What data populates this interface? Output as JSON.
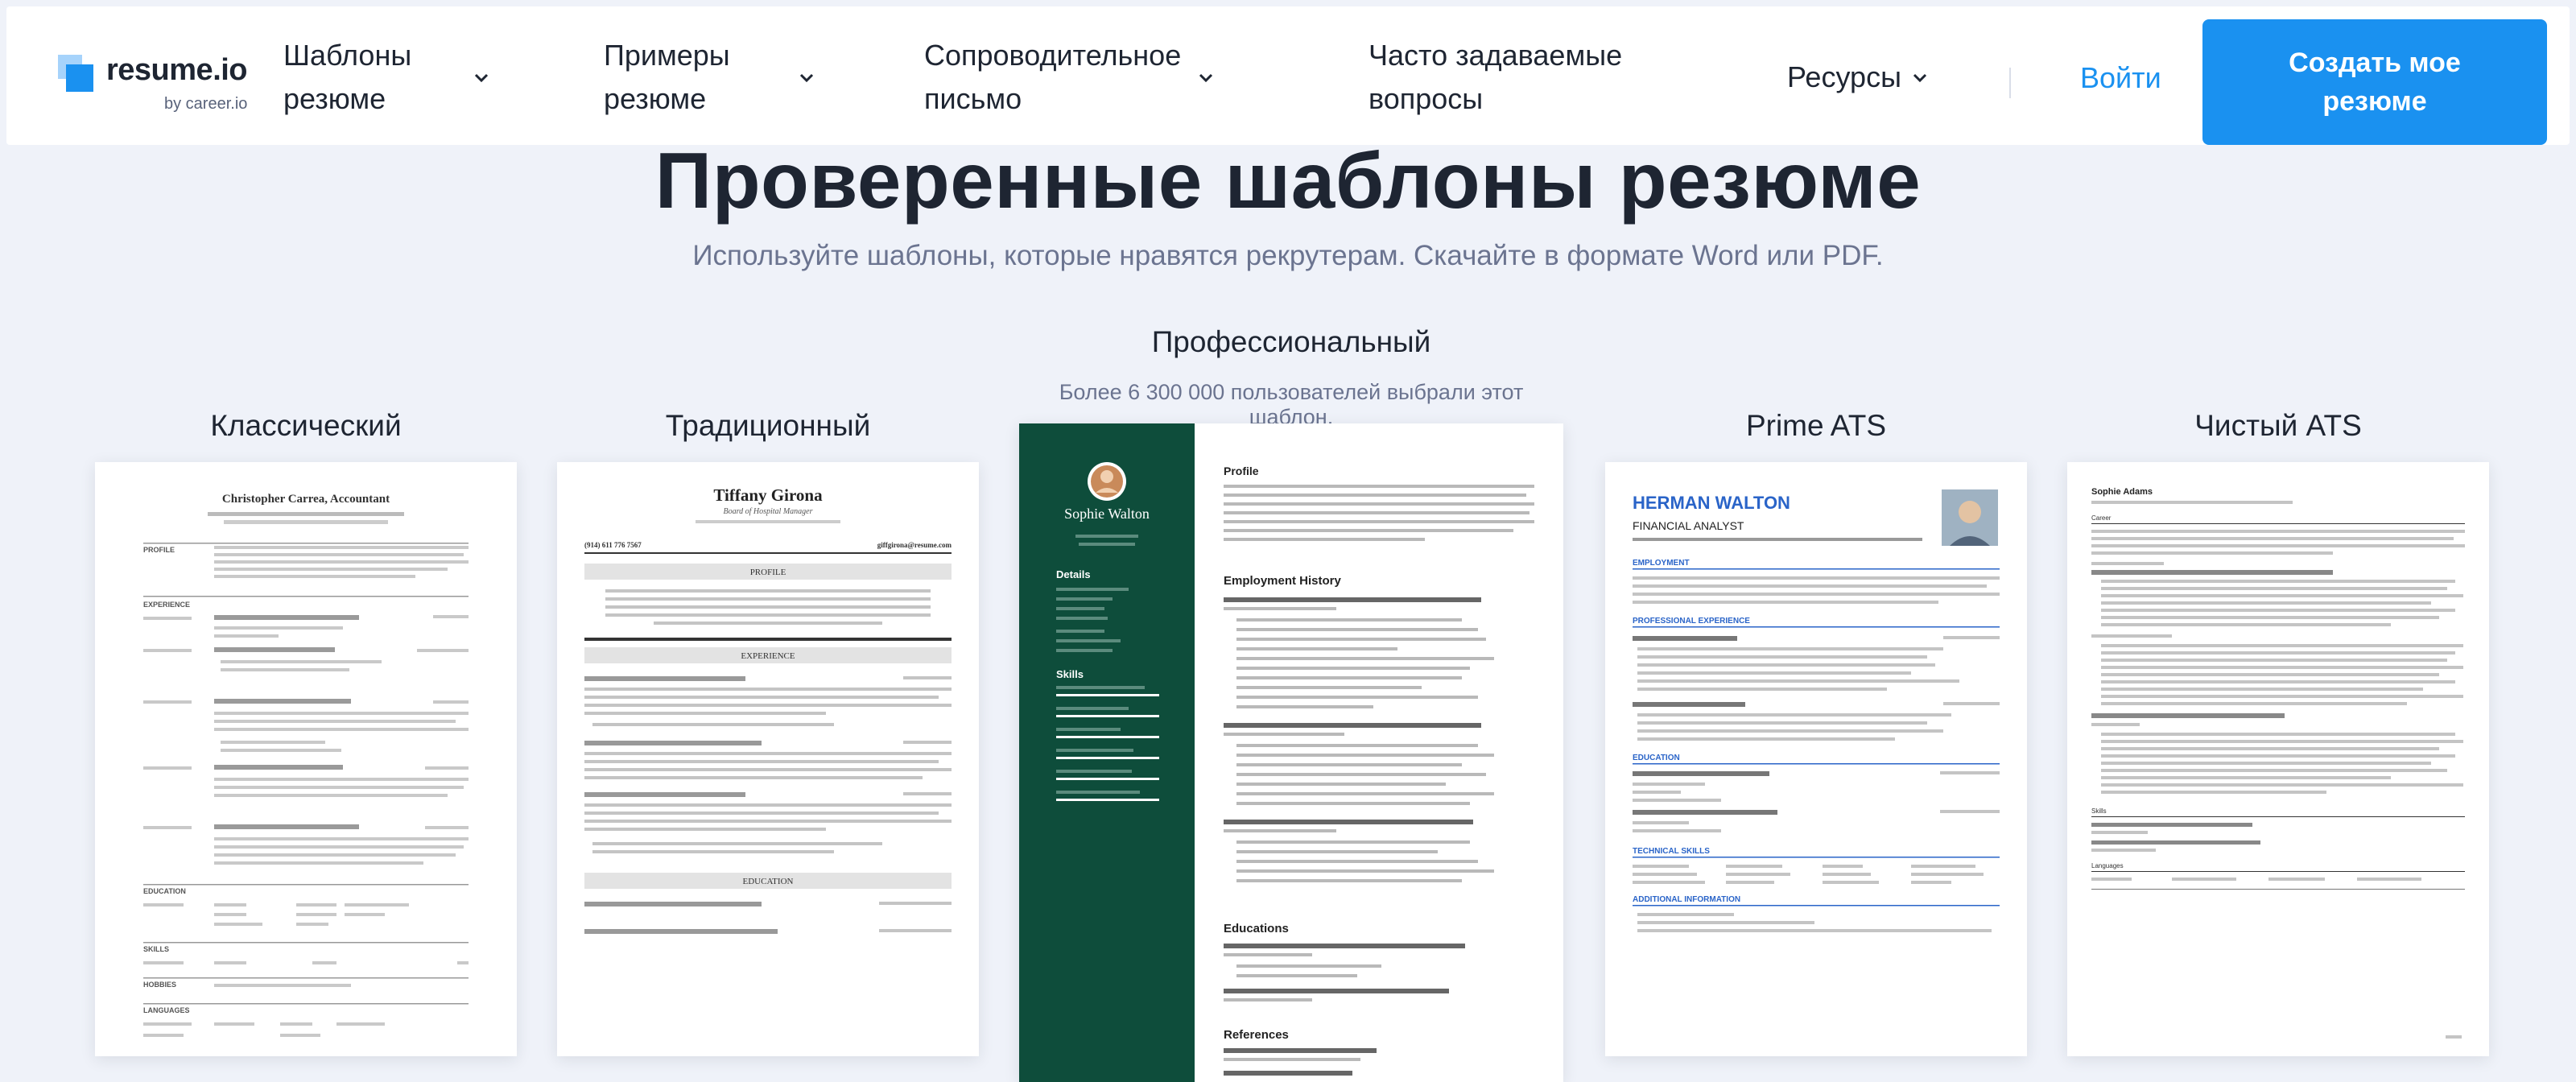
{
  "nav": {
    "logo_text": "resume.io",
    "logo_sub": "by career.io",
    "items": [
      {
        "line1": "Шаблоны",
        "line2": "резюме"
      },
      {
        "line1": "Примеры",
        "line2": "резюме"
      },
      {
        "line1": "Сопроводительное",
        "line2": "письмо"
      },
      {
        "line1": "Часто задаваемые",
        "line2": "вопросы"
      },
      {
        "line1": "Ресурсы",
        "line2": ""
      }
    ],
    "login": "Войти",
    "cta_line1": "Создать мое",
    "cta_line2": "резюме"
  },
  "hero": {
    "title": "Проверенные шаблоны резюме",
    "subtitle": "Используйте шаблоны, которые нравятся рекрутерам. Скачайте в формате Word или PDF."
  },
  "templates": [
    {
      "label": "Классический"
    },
    {
      "label": "Традиционный"
    },
    {
      "label": "Профессиональный",
      "note": "Более 6 300 000 пользователей выбрали этот шаблон."
    },
    {
      "label": "Prime ATS"
    },
    {
      "label": "Чистый ATS"
    }
  ],
  "previews": {
    "classic": {
      "name": "Christopher Carrea, Accountant",
      "sections": [
        "PROFILE",
        "EXPERIENCE",
        "EDUCATION",
        "SKILLS",
        "HOBBIES",
        "LANGUAGES"
      ]
    },
    "traditional": {
      "name": "Tiffany Girona",
      "role": "Board of Hospital Manager",
      "phone": "(914) 611 776 7567",
      "email": "giffgirona@resume.com",
      "sections": [
        "PROFILE",
        "EXPERIENCE",
        "EDUCATION"
      ]
    },
    "professional": {
      "name": "Sophie Walton",
      "sidebar_sections": [
        "Details",
        "Skills"
      ],
      "sections": [
        "Profile",
        "Employment History",
        "Educations",
        "References"
      ]
    },
    "prime": {
      "name": "HERMAN WALTON",
      "role": "FINANCIAL ANALYST",
      "sections": [
        "EMPLOYMENT",
        "PROFESSIONAL EXPERIENCE",
        "EDUCATION",
        "TECHNICAL SKILLS",
        "ADDITIONAL INFORMATION"
      ]
    },
    "clean": {
      "name": "Sophie Adams",
      "sections": [
        "Career",
        "Skills",
        "Languages"
      ]
    }
  },
  "colors": {
    "accent": "#1a91f0",
    "page_bg": "#eff2f9",
    "text": "#1e2532",
    "muted": "#6b7490",
    "professional_sidebar": "#0e4d3b",
    "prime_blue": "#2a64c8"
  }
}
